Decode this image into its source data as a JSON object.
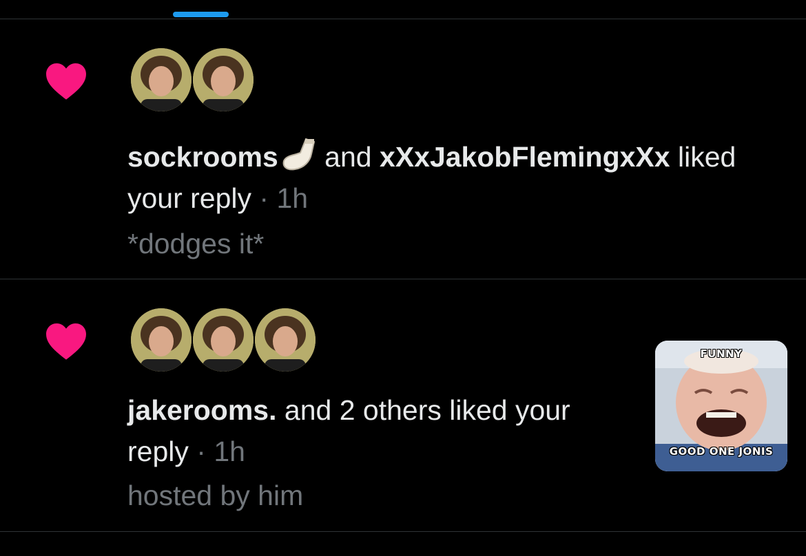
{
  "colors": {
    "background": "#000000",
    "heart": "#f91880",
    "tab_indicator": "#1d9bf0",
    "text_primary": "#e7e9ea",
    "text_secondary": "#71767b",
    "divider": "#2f3336"
  },
  "notifications": [
    {
      "icon": "heart-icon",
      "avatar_count": 2,
      "actor1": "sockrooms",
      "actor1_emoji": "sock-icon",
      "connector": "and",
      "actor2": "xXxJakobFlemingxXx",
      "action": "liked your reply",
      "action_part1": "liked",
      "action_part2": "your reply",
      "separator": "·",
      "time": "1h",
      "preview": "*dodges it*"
    },
    {
      "icon": "heart-icon",
      "avatar_count": 3,
      "actor1": "jakerooms.",
      "rest": "and 2 others liked your",
      "rest_line2": "reply",
      "separator": "·",
      "time": "1h",
      "preview": "hosted by him",
      "media": {
        "top_caption": "FUNNY",
        "bottom_caption": "GOOD ONE JONIS"
      }
    }
  ]
}
